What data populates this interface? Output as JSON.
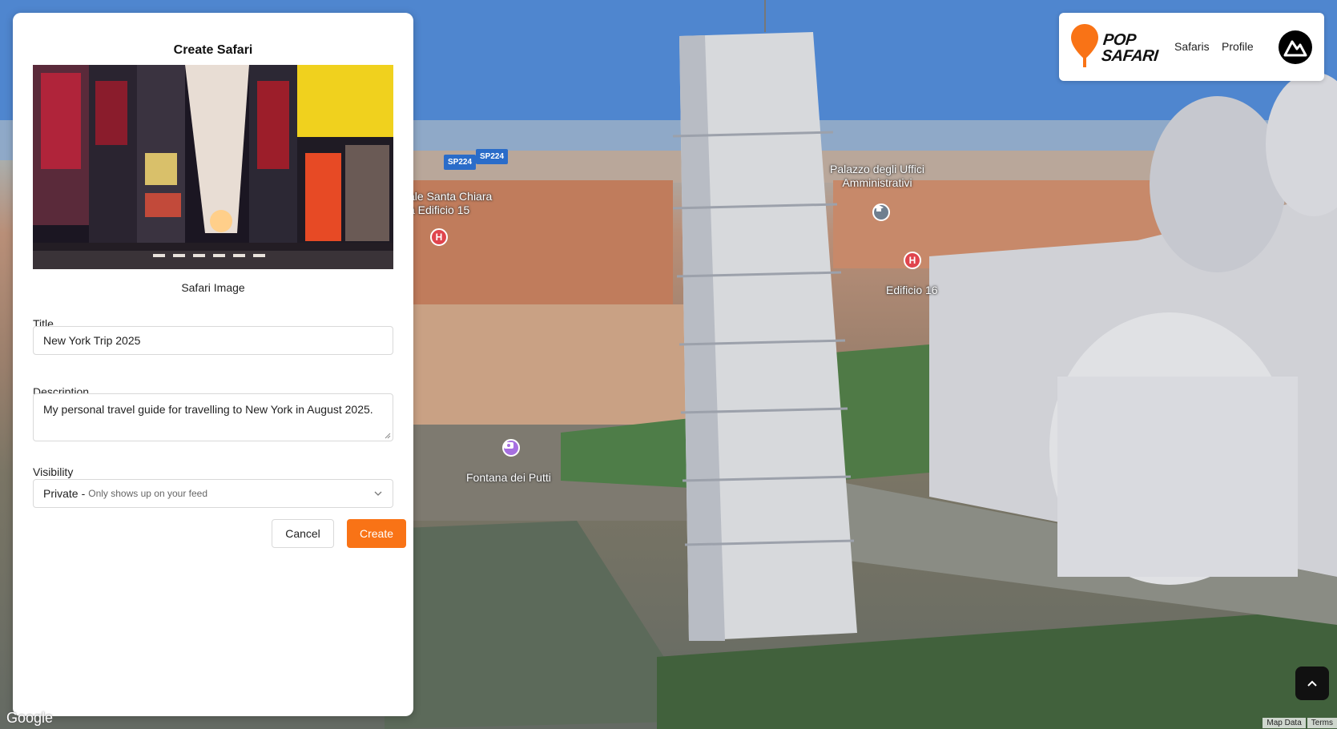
{
  "panel": {
    "title": "Create Safari",
    "image_caption": "Safari Image",
    "title_label": "Title",
    "title_value": "New York Trip 2025",
    "description_label": "Description",
    "description_value": "My personal travel guide for travelling to New York in August 2025.",
    "visibility_label": "Visibility",
    "visibility_value": "Private",
    "visibility_separator": "-",
    "visibility_hint": "Only shows up on your feed",
    "cancel_label": "Cancel",
    "create_label": "Create"
  },
  "nav": {
    "logo_line1": "POP",
    "logo_line2": "SAFARI",
    "links": [
      "Safaris",
      "Profile"
    ]
  },
  "map": {
    "labels": {
      "palazzo_line1": "Palazzo degli Uffici",
      "palazzo_line2": "Amministrativi",
      "santa_chiara_line1": "ale Santa Chiara",
      "santa_chiara_line2": "a Edificio 15",
      "edificio16": "Edificio 16",
      "fontana": "Fontana dei Putti"
    },
    "road_shields": [
      "SP224",
      "SP224"
    ],
    "hospital_pin": "H",
    "google_logo": "Google",
    "attribution": [
      "Map Data",
      "Terms"
    ]
  },
  "colors": {
    "accent": "#f97316",
    "logo_pin": "#f97316"
  }
}
